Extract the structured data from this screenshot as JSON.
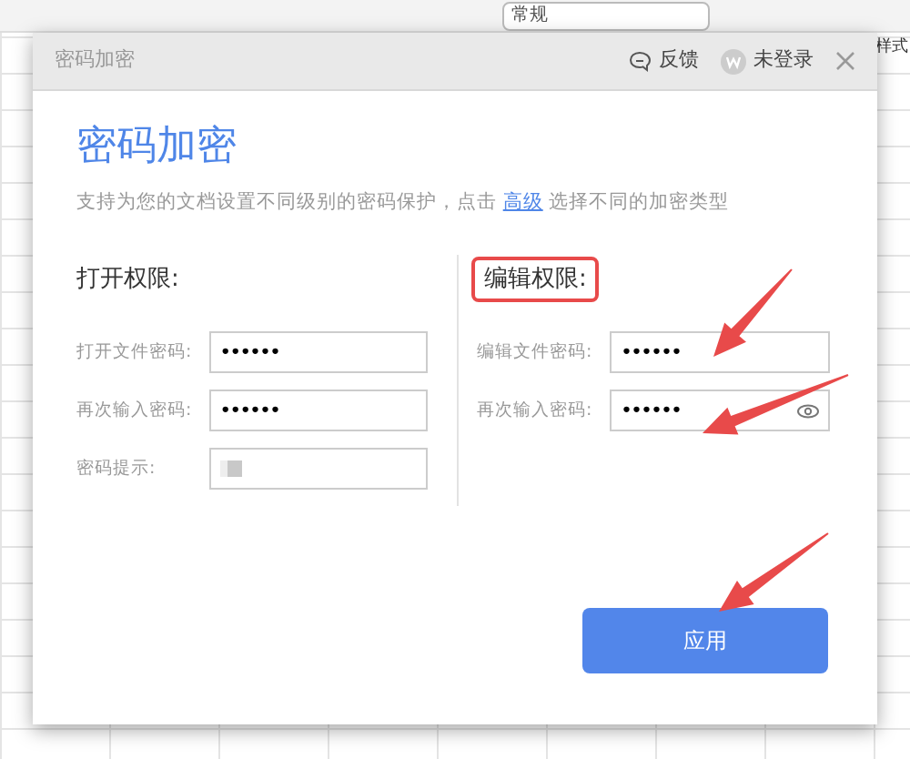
{
  "background": {
    "format_dropdown": "常规",
    "style_label": "样式"
  },
  "dialog": {
    "title": "密码加密",
    "feedback": "反馈",
    "login": "未登录",
    "heading": "密码加密",
    "description": {
      "before": "支持为您的文档设置不同级别的密码保护，点击",
      "link": "高级",
      "after": "选择不同的加密类型"
    },
    "sections": [
      {
        "title": "打开权限:",
        "highlighted": false,
        "fields": [
          {
            "label": "打开文件密码:",
            "value": "••••••",
            "kind": "password",
            "show_toggle": false
          },
          {
            "label": "再次输入密码:",
            "value": "••••••",
            "kind": "password",
            "show_toggle": false
          },
          {
            "label": "密码提示:",
            "kind": "redacted"
          }
        ]
      },
      {
        "title": "编辑权限:",
        "highlighted": true,
        "fields": [
          {
            "label": "编辑文件密码:",
            "value": "••••••",
            "kind": "password",
            "show_toggle": false
          },
          {
            "label": "再次输入密码:",
            "value": "••••••",
            "kind": "password",
            "show_toggle": true
          }
        ]
      }
    ],
    "apply_button": "应用"
  }
}
